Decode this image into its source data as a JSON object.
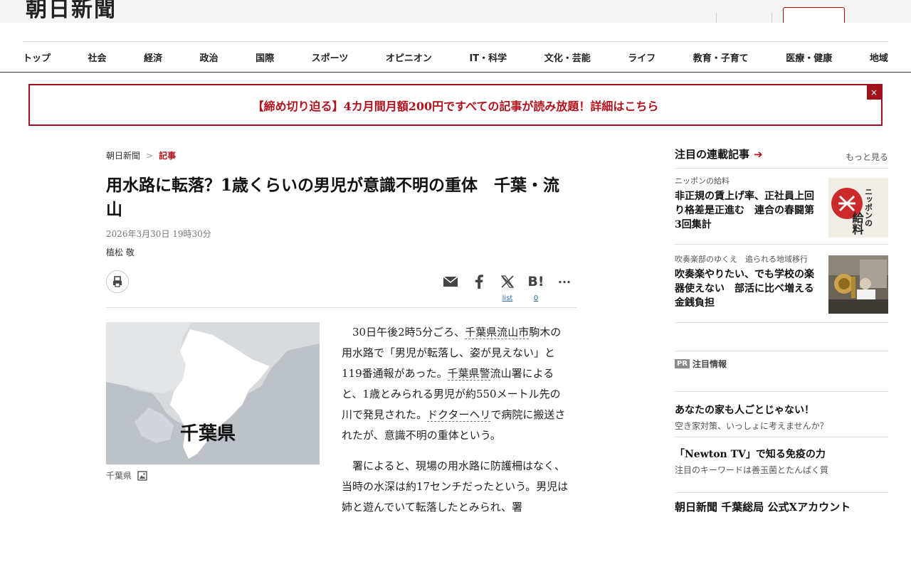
{
  "header": {
    "logo_text": "朝日新聞"
  },
  "nav": {
    "items": [
      "トップ",
      "社会",
      "経済",
      "政治",
      "国際",
      "スポーツ",
      "オピニオン",
      "IT・科学",
      "文化・芸能",
      "ライフ",
      "教育・子育て",
      "医療・健康",
      "地域"
    ]
  },
  "promo": {
    "text": "【締め切り迫る】4カ月間月額200円ですべての記事が読み放題！詳細はこちら",
    "close_label": "×"
  },
  "breadcrumb": {
    "home": "朝日新聞",
    "sep": ">",
    "current": "記事"
  },
  "article": {
    "headline": "用水路に転落？1歳くらいの男児が意識不明の重体　千葉・流山",
    "date": "2026年3月30日 19時30分",
    "author": "植松 敬",
    "share": {
      "twitter_count": "list",
      "hatena_count": "0",
      "hatena_label": "B!",
      "more_label": "···"
    },
    "map_label": "千葉県",
    "map_caption": "千葉県",
    "p1": {
      "t1": "30日午後2時5分ごろ、",
      "l1": "千葉県流山市",
      "t2": "駒木の用水路で「男児が転落し、姿が見えない」と119番通報があった。",
      "l2": "千葉県警",
      "t3": "流山署によると、1歳とみられる男児が約550メートル先の川で発見された。",
      "l3": "ドクターヘリ",
      "t4": "で病院に搬送されたが、意識不明の重体という。"
    },
    "p2": "署によると、現場の用水路に防護柵はなく、当時の水深は約17センチだったという。男児は姉と遊んでいて転落したとみられ、署"
  },
  "sidebar": {
    "title": "注目の連載記事",
    "arrow": "➔",
    "more": "もっと見る",
    "items": [
      {
        "category": "ニッポンの給料",
        "title": "非正規の賃上げ率、正社員上回り格差是正進む　連合の春闘第3回集計",
        "thumb_text_1": "ニッポンの",
        "thumb_text_2": "給料"
      },
      {
        "category": "吹奏楽部のゆくえ　追られる地域移行",
        "title": "吹奏楽やりたい、でも学校の楽器使えない　部活に比べ増える金銭負担"
      }
    ],
    "pr": {
      "badge": "PR",
      "title": "注目情報",
      "items": [
        {
          "title": "あなたの家も人ごとじゃない！",
          "sub": "空き家対策、いっしょに考えませんか？"
        },
        {
          "title": "「Newton TV」で知る免疫の力",
          "sub": "注目のキーワードは善玉菌とたんぱく質"
        }
      ]
    },
    "bottom_title": "朝日新聞 千葉総局 公式Xアカウント"
  },
  "colors": {
    "accent": "#b3121d",
    "map_land": "#ffffff",
    "map_sea": "#bcc2c8"
  }
}
